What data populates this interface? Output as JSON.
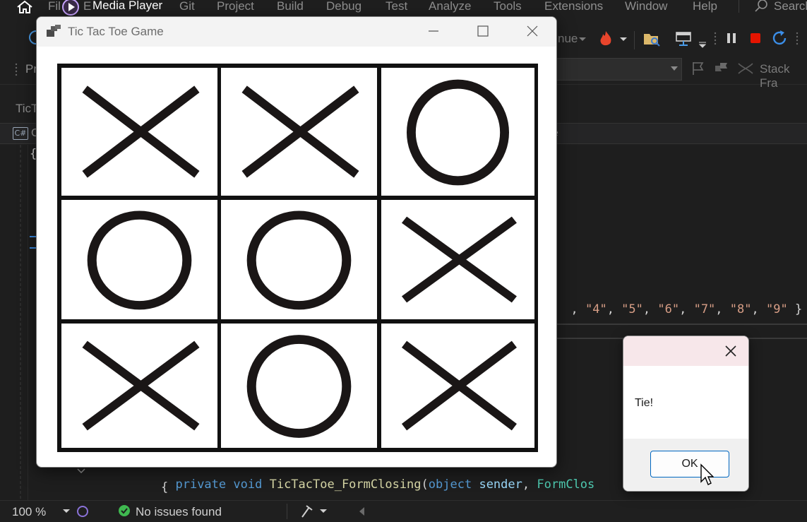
{
  "menubar": {
    "media_player_label": "Media Player",
    "items": [
      {
        "label": "File",
        "shown": "Fil"
      },
      {
        "label": "E",
        "shown": "E"
      },
      {
        "label": "Git"
      },
      {
        "label": "Project"
      },
      {
        "label": "Build"
      },
      {
        "label": "Debug"
      },
      {
        "label": "Test"
      },
      {
        "label": "Analyze"
      },
      {
        "label": "Tools"
      },
      {
        "label": "Extensions"
      },
      {
        "label": "Window"
      },
      {
        "label": "Help"
      }
    ],
    "search_label": "Search"
  },
  "toolbar": {
    "continue_fragment": "nue",
    "pr_fragment": "Pr",
    "stack_frame_label": "Stack Fra"
  },
  "tabs": {
    "doc_tab_fragment": "TicT"
  },
  "navbar": {
    "left_fragment": "C",
    "right_fragment": "e"
  },
  "editor": {
    "brace_open": "{",
    "array_fragment": [
      ", ",
      "\"4\"",
      ", ",
      "\"5\"",
      ", ",
      "\"6\"",
      ", ",
      "\"7\"",
      ", ",
      "\"8\"",
      ", ",
      "\"9\"",
      " }"
    ],
    "method_line": {
      "kw1": "private",
      "kw2": "void",
      "method": "TicTacToe_FormClosing",
      "paren": "(",
      "type1": "object",
      "param1": "sender",
      "comma": ",",
      "type2": "FormClos"
    },
    "brace_line": "{"
  },
  "statusbar": {
    "zoom": "100 %",
    "issues_text": "No issues found"
  },
  "game_window": {
    "title": "Tic Tac Toe Game",
    "board": [
      [
        "X",
        "X",
        "O"
      ],
      [
        "O",
        "O",
        "X"
      ],
      [
        "X",
        "O",
        "X"
      ]
    ]
  },
  "message_box": {
    "text": "Tie!",
    "ok_label": "OK"
  },
  "colors": {
    "keyword": "#569cd6",
    "type": "#4ec9b0",
    "string": "#d69d85",
    "method": "#dcdcaa",
    "param": "#9cdcfe",
    "accent": "#0067c0",
    "error_red": "#e51400"
  }
}
